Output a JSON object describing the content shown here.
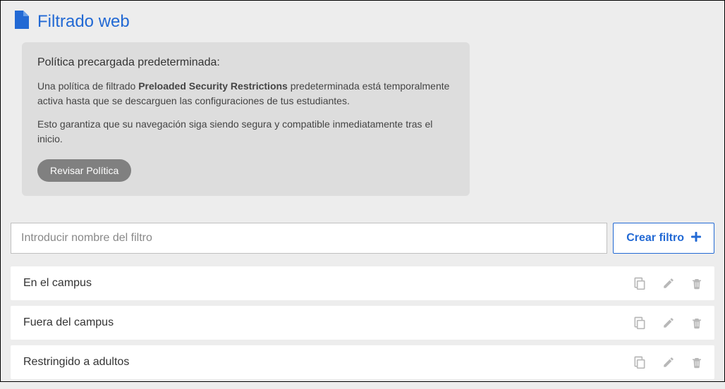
{
  "header": {
    "title": "Filtrado web"
  },
  "notice": {
    "title": "Política precargada predeterminada:",
    "p1_a": "Una política de filtrado ",
    "p1_bold": "Preloaded Security Restrictions",
    "p1_b": " predeterminada está temporalmente activa hasta que se descarguen las configuraciones de tus estudiantes.",
    "p2": "Esto garantiza que su navegación siga siendo segura y compatible inmediatamente tras el inicio.",
    "button": "Revisar Política"
  },
  "create": {
    "placeholder": "Introducir nombre del filtro",
    "button": "Crear filtro"
  },
  "filters": [
    {
      "label": "En el campus"
    },
    {
      "label": "Fuera del campus"
    },
    {
      "label": "Restringido a adultos"
    }
  ]
}
